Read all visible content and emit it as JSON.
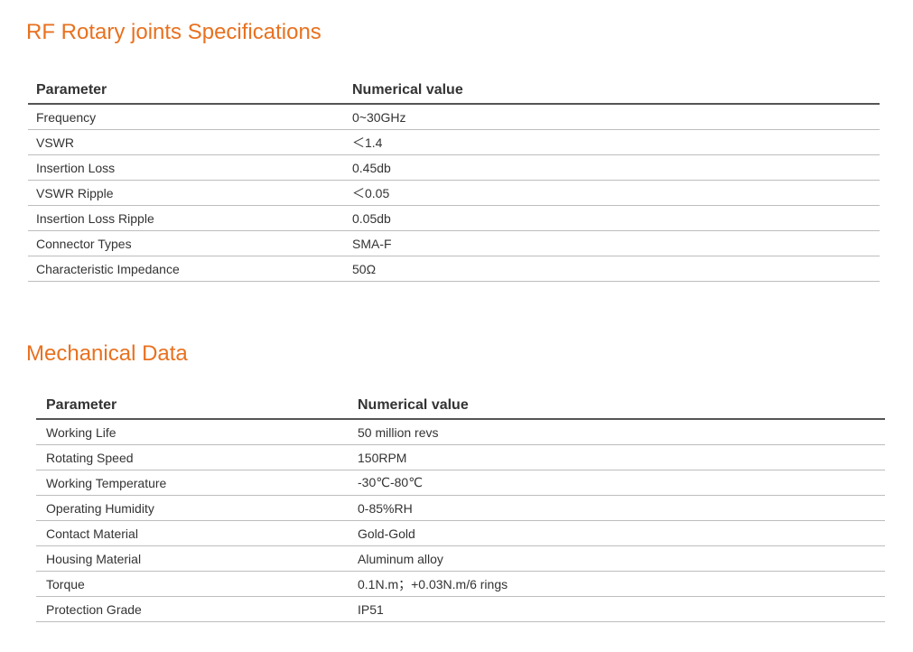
{
  "rf_section": {
    "title": "RF Rotary joints Specifications",
    "header": {
      "parameter": "Parameter",
      "value": "Numerical value"
    },
    "rows": [
      {
        "parameter": "Frequency",
        "value": "0~30GHz"
      },
      {
        "parameter": "VSWR",
        "value": "＜1.4"
      },
      {
        "parameter": "Insertion Loss",
        "value": "0.45db"
      },
      {
        "parameter": "VSWR Ripple",
        "value": "＜0.05"
      },
      {
        "parameter": "Insertion Loss Ripple",
        "value": "0.05db"
      },
      {
        "parameter": "Connector Types",
        "value": "SMA-F"
      },
      {
        "parameter": "Characteristic Impedance",
        "value": "50Ω"
      }
    ]
  },
  "mech_section": {
    "title": "Mechanical Data",
    "header": {
      "parameter": "Parameter",
      "value": "Numerical value"
    },
    "rows": [
      {
        "parameter": "Working Life",
        "value": "50 million revs"
      },
      {
        "parameter": "Rotating Speed",
        "value": "150RPM"
      },
      {
        "parameter": "Working Temperature",
        "value": "-30℃-80℃"
      },
      {
        "parameter": "Operating Humidity",
        "value": "0-85%RH"
      },
      {
        "parameter": "Contact Material",
        "value": "Gold-Gold"
      },
      {
        "parameter": "Housing Material",
        "value": "Aluminum alloy"
      },
      {
        "parameter": "Torque",
        "value": "0.1N.m；+0.03N.m/6 rings"
      },
      {
        "parameter": "Protection Grade",
        "value": "IP51"
      }
    ]
  },
  "colors": {
    "title": "#e8711f",
    "text": "#333333",
    "header_rule": "#555555",
    "row_rule": "#bdbdbd"
  }
}
